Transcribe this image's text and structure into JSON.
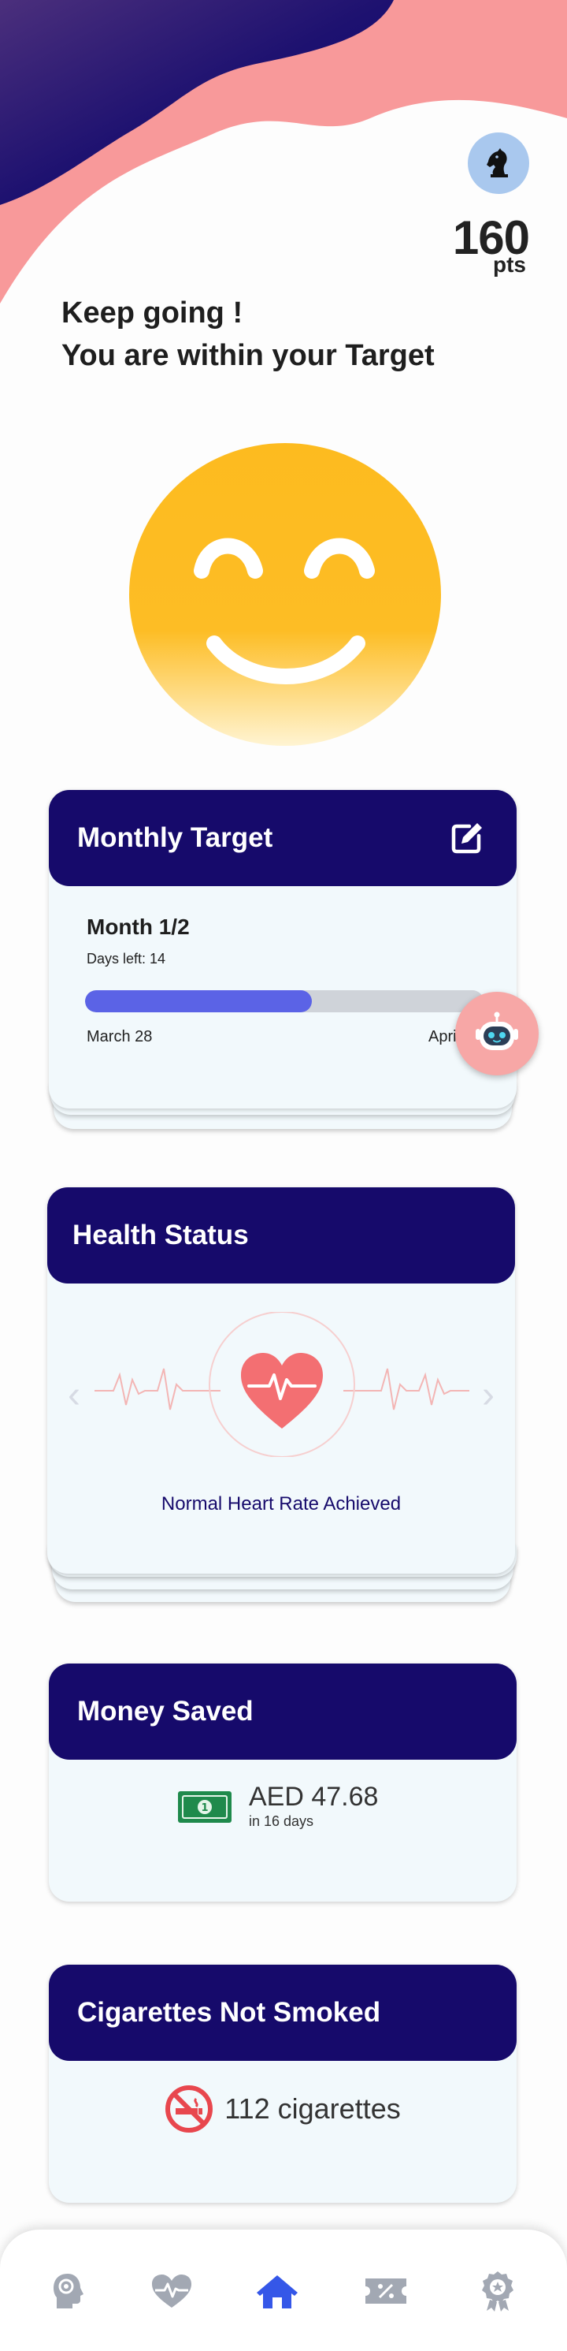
{
  "points": {
    "value": "160",
    "unit": "pts",
    "avatar_icon": "knight-chess-icon"
  },
  "motivation": {
    "line1": "Keep going !",
    "line2": "You are within your Target"
  },
  "mood_icon": "happy-face-icon",
  "monthly_target": {
    "title": "Monthly Target",
    "month_label": "Month 1/2",
    "days_left": "Days left: 14",
    "progress": 0.57,
    "start_label": "March 28",
    "end_label": "April"
  },
  "health_status": {
    "title": "Health Status",
    "status_text": "Normal Heart Rate Achieved",
    "icon": "heart-pulse-icon"
  },
  "money_saved": {
    "title": "Money Saved",
    "amount": "AED 47.68",
    "period": "in 16 days",
    "icon": "banknote-icon"
  },
  "cigarettes": {
    "title": "Cigarettes Not Smoked",
    "count": "112 cigarettes",
    "icon": "no-smoking-icon"
  },
  "nav": {
    "active_index": 2,
    "items": [
      {
        "icon": "brain-head-icon"
      },
      {
        "icon": "heart-pulse-icon"
      },
      {
        "icon": "home-icon"
      },
      {
        "icon": "ticket-percent-icon"
      },
      {
        "icon": "award-badge-icon"
      }
    ]
  },
  "colors": {
    "navy": "#160a6b",
    "salmon": "#f8999a",
    "progress": "#5b63e6",
    "card_bg": "#f2f9fc",
    "active_nav": "#3557e8",
    "inactive_nav": "#a2a8b3"
  }
}
